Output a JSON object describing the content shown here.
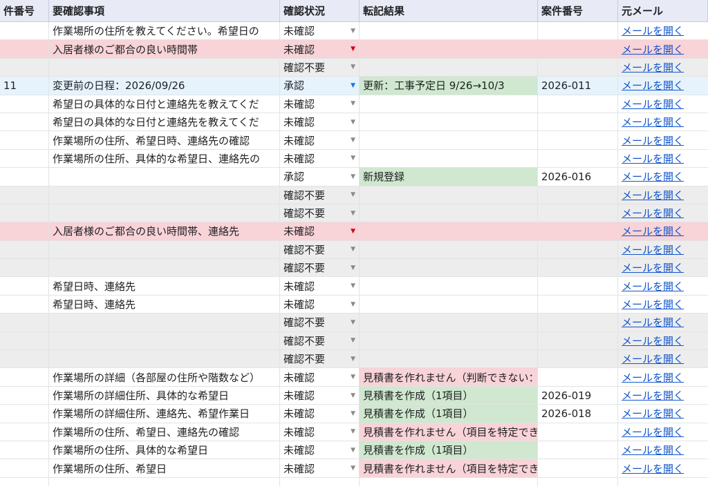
{
  "headers": {
    "id": "件番号",
    "item": "要確認事項",
    "status": "確認状況",
    "result": "転記結果",
    "case": "案件番号",
    "mail": "元メール"
  },
  "rows": [
    {
      "id": "",
      "item": "作業場所の住所を教えてください。希望日の",
      "status": "未確認",
      "result": "",
      "case": "",
      "mail": "メールを開く",
      "row_style": "white",
      "result_style": "none",
      "dd_color": "gray"
    },
    {
      "id": "",
      "item": "入居者様のご都合の良い時間帯",
      "status": "未確認",
      "result": "",
      "case": "",
      "mail": "メールを開く",
      "row_style": "pink",
      "result_style": "none",
      "dd_color": "red"
    },
    {
      "id": "",
      "item": "",
      "status": "確認不要",
      "result": "",
      "case": "",
      "mail": "メールを開く",
      "row_style": "gray",
      "result_style": "none",
      "dd_color": "gray"
    },
    {
      "id": "11",
      "item": "変更前の日程：2026/09/26",
      "status": "承認",
      "result": "更新：工事予定日 9/26→10/3",
      "case": "2026-011",
      "mail": "メールを開く",
      "row_style": "blue",
      "result_style": "green",
      "dd_color": "blue"
    },
    {
      "id": "",
      "item": "希望日の具体的な日付と連絡先を教えてくだ",
      "status": "未確認",
      "result": "",
      "case": "",
      "mail": "メールを開く",
      "row_style": "white",
      "result_style": "none",
      "dd_color": "gray"
    },
    {
      "id": "",
      "item": "希望日の具体的な日付と連絡先を教えてくだ",
      "status": "未確認",
      "result": "",
      "case": "",
      "mail": "メールを開く",
      "row_style": "white",
      "result_style": "none",
      "dd_color": "gray"
    },
    {
      "id": "",
      "item": "作業場所の住所、希望日時、連絡先の確認",
      "status": "未確認",
      "result": "",
      "case": "",
      "mail": "メールを開く",
      "row_style": "white",
      "result_style": "none",
      "dd_color": "gray"
    },
    {
      "id": "",
      "item": "作業場所の住所、具体的な希望日、連絡先の",
      "status": "未確認",
      "result": "",
      "case": "",
      "mail": "メールを開く",
      "row_style": "white",
      "result_style": "none",
      "dd_color": "gray"
    },
    {
      "id": "",
      "item": "",
      "status": "承認",
      "result": "新規登録",
      "case": "2026-016",
      "mail": "メールを開く",
      "row_style": "white",
      "result_style": "green",
      "dd_color": "gray"
    },
    {
      "id": "",
      "item": "",
      "status": "確認不要",
      "result": "",
      "case": "",
      "mail": "メールを開く",
      "row_style": "gray",
      "result_style": "none",
      "dd_color": "gray"
    },
    {
      "id": "",
      "item": "",
      "status": "確認不要",
      "result": "",
      "case": "",
      "mail": "メールを開く",
      "row_style": "gray",
      "result_style": "none",
      "dd_color": "gray"
    },
    {
      "id": "",
      "item": "入居者様のご都合の良い時間帯、連絡先",
      "status": "未確認",
      "result": "",
      "case": "",
      "mail": "メールを開く",
      "row_style": "pink",
      "result_style": "none",
      "dd_color": "red"
    },
    {
      "id": "",
      "item": "",
      "status": "確認不要",
      "result": "",
      "case": "",
      "mail": "メールを開く",
      "row_style": "gray",
      "result_style": "none",
      "dd_color": "gray"
    },
    {
      "id": "",
      "item": "",
      "status": "確認不要",
      "result": "",
      "case": "",
      "mail": "メールを開く",
      "row_style": "gray",
      "result_style": "none",
      "dd_color": "gray"
    },
    {
      "id": "",
      "item": "希望日時、連絡先",
      "status": "未確認",
      "result": "",
      "case": "",
      "mail": "メールを開く",
      "row_style": "white",
      "result_style": "none",
      "dd_color": "gray"
    },
    {
      "id": "",
      "item": "希望日時、連絡先",
      "status": "未確認",
      "result": "",
      "case": "",
      "mail": "メールを開く",
      "row_style": "white",
      "result_style": "none",
      "dd_color": "gray"
    },
    {
      "id": "",
      "item": "",
      "status": "確認不要",
      "result": "",
      "case": "",
      "mail": "メールを開く",
      "row_style": "gray",
      "result_style": "none",
      "dd_color": "gray"
    },
    {
      "id": "",
      "item": "",
      "status": "確認不要",
      "result": "",
      "case": "",
      "mail": "メールを開く",
      "row_style": "gray",
      "result_style": "none",
      "dd_color": "gray"
    },
    {
      "id": "",
      "item": "",
      "status": "確認不要",
      "result": "",
      "case": "",
      "mail": "メールを開く",
      "row_style": "gray",
      "result_style": "none",
      "dd_color": "gray"
    },
    {
      "id": "",
      "item": "作業場所の詳細（各部屋の住所や階数など）",
      "status": "未確認",
      "result": "見積書を作れません（判断できない：作業内容が",
      "case": "",
      "mail": "メールを開く",
      "row_style": "white",
      "result_style": "red",
      "dd_color": "gray"
    },
    {
      "id": "",
      "item": "作業場所の詳細住所、具体的な希望日",
      "status": "未確認",
      "result": "見積書を作成（1項目）",
      "case": "2026-019",
      "mail": "メールを開く",
      "row_style": "white",
      "result_style": "green",
      "dd_color": "gray"
    },
    {
      "id": "",
      "item": "作業場所の詳細住所、連絡先、希望作業日",
      "status": "未確認",
      "result": "見積書を作成（1項目）",
      "case": "2026-018",
      "mail": "メールを開く",
      "row_style": "white",
      "result_style": "green",
      "dd_color": "gray"
    },
    {
      "id": "",
      "item": "作業場所の住所、希望日、連絡先の確認",
      "status": "未確認",
      "result": "見積書を作れません（項目を特定できず：屋上防",
      "case": "",
      "mail": "メールを開く",
      "row_style": "white",
      "result_style": "red",
      "dd_color": "gray"
    },
    {
      "id": "",
      "item": "作業場所の住所、具体的な希望日",
      "status": "未確認",
      "result": "見積書を作成（1項目）",
      "case": "",
      "mail": "メールを開く",
      "row_style": "white",
      "result_style": "green",
      "dd_color": "gray"
    },
    {
      "id": "",
      "item": "作業場所の住所、希望日",
      "status": "未確認",
      "result": "見積書を作れません（項目を特定できず：配管点",
      "case": "",
      "mail": "メールを開く",
      "row_style": "white",
      "result_style": "red",
      "dd_color": "gray"
    }
  ],
  "dropdown_icon": "triangle-down-icon",
  "colors": {
    "header_bg": "#e8eaf6",
    "pink_row": "#f8d3d7",
    "gray_row": "#ededed",
    "blue_row": "#e6f3fd",
    "green_cell": "#cfe8cf",
    "link": "#1155cc"
  }
}
